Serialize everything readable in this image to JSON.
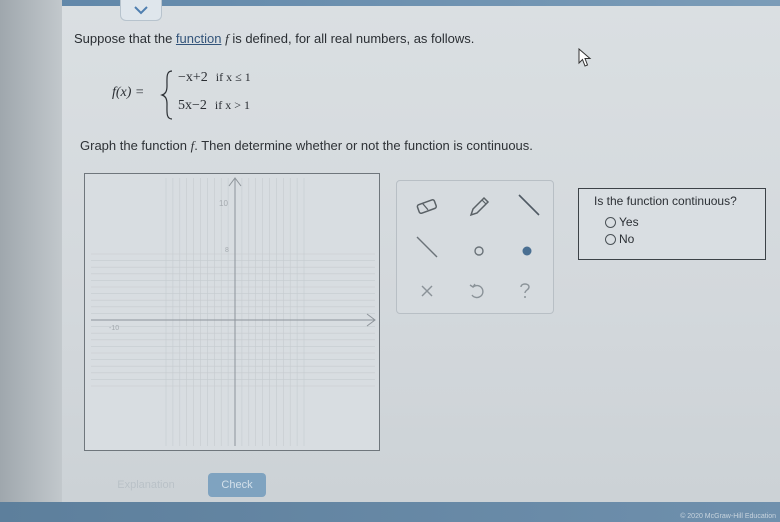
{
  "prompt": {
    "before_link": "Suppose that the ",
    "link_text": "function",
    "func_name": "f",
    "after_link": " is defined, for all real numbers, as follows."
  },
  "piecewise": {
    "lhs": "f(x) =",
    "case1_expr": "−x+2",
    "case1_cond": "if x ≤ 1",
    "case2_expr": "5x−2",
    "case2_cond": "if x > 1"
  },
  "instruction": {
    "before": "Graph the function ",
    "func_name": "f",
    "after": ". Then determine whether or not the function is continuous."
  },
  "graph": {
    "tick_label_top": "10",
    "tick_label_mid": "8",
    "tick_label_left": "-10"
  },
  "tools": [
    "eraser-icon",
    "pencil-icon",
    "line-tool-icon",
    "ray-tool-icon",
    "open-point-icon",
    "closed-point-icon",
    "clear-icon",
    "undo-icon",
    "help-icon"
  ],
  "question": {
    "title": "Is the function continuous?",
    "options": [
      "Yes",
      "No"
    ]
  },
  "buttons": {
    "explanation": "Explanation",
    "check": "Check"
  },
  "footer": "© 2020 McGraw-Hill Education",
  "colors": {
    "link": "#33547a",
    "check_button": "#7fa3c0",
    "closed_point": "#4a6f92"
  }
}
